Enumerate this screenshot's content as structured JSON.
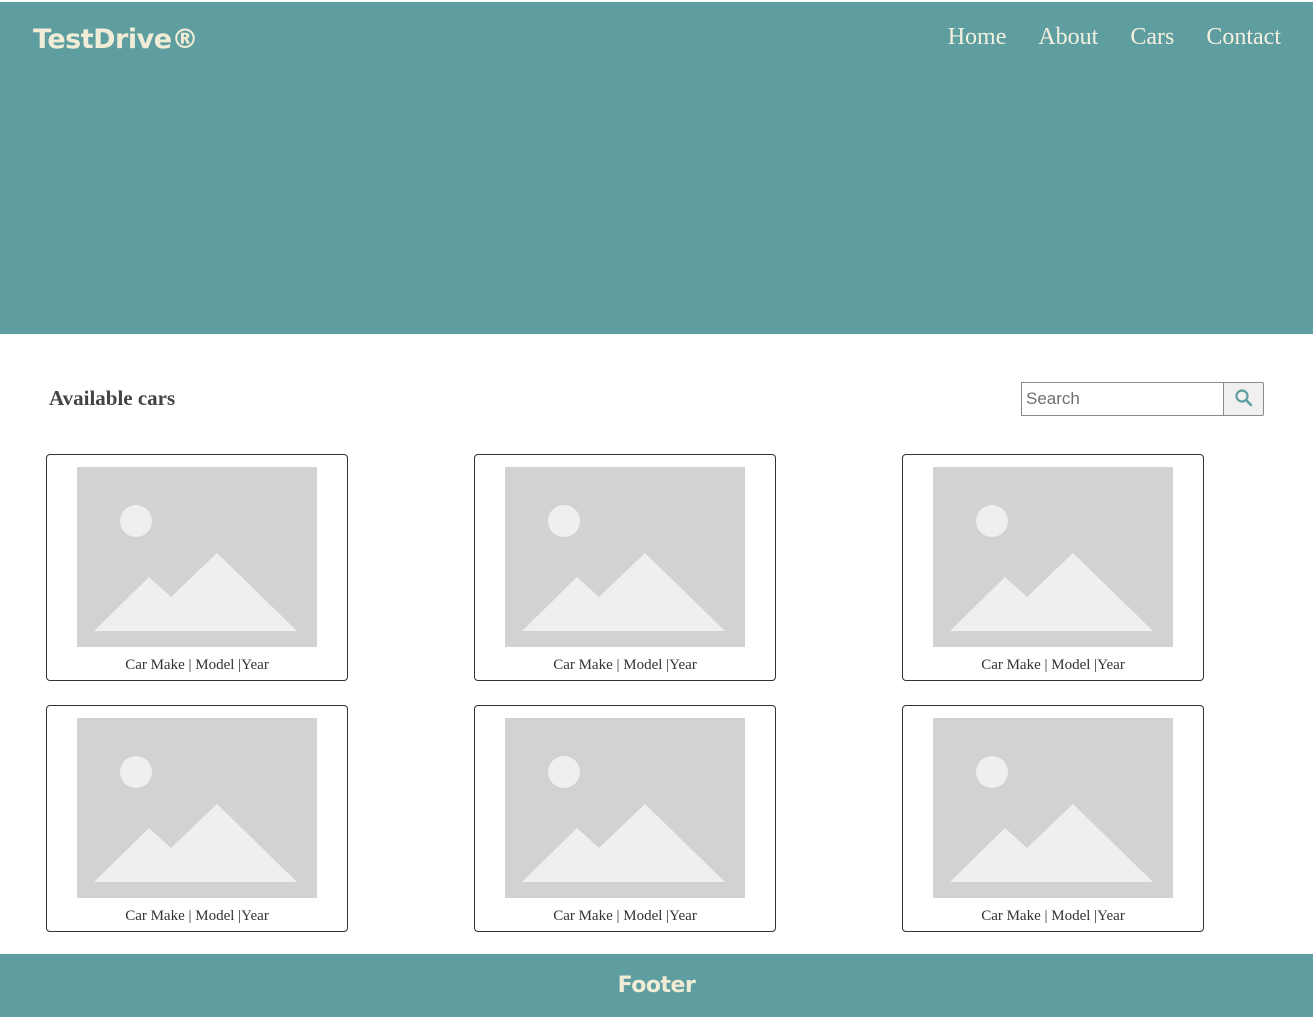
{
  "header": {
    "logo": "TestDrive®",
    "nav": [
      "Home",
      "About",
      "Cars",
      "Contact"
    ],
    "background_color": "#5f9ea0"
  },
  "main": {
    "section_title": "Available cars",
    "search": {
      "placeholder": "Search",
      "value": "",
      "button_icon": "search-icon"
    },
    "cards": [
      {
        "caption": "Car Make | Model |Year",
        "image_icon": "image-placeholder-icon"
      },
      {
        "caption": "Car Make | Model |Year",
        "image_icon": "image-placeholder-icon"
      },
      {
        "caption": "Car Make | Model |Year",
        "image_icon": "image-placeholder-icon"
      },
      {
        "caption": "Car Make | Model |Year",
        "image_icon": "image-placeholder-icon"
      },
      {
        "caption": "Car Make | Model |Year",
        "image_icon": "image-placeholder-icon"
      },
      {
        "caption": "Car Make | Model |Year",
        "image_icon": "image-placeholder-icon"
      }
    ]
  },
  "footer": {
    "label": "Footer",
    "background_color": "#5f9ea0"
  }
}
